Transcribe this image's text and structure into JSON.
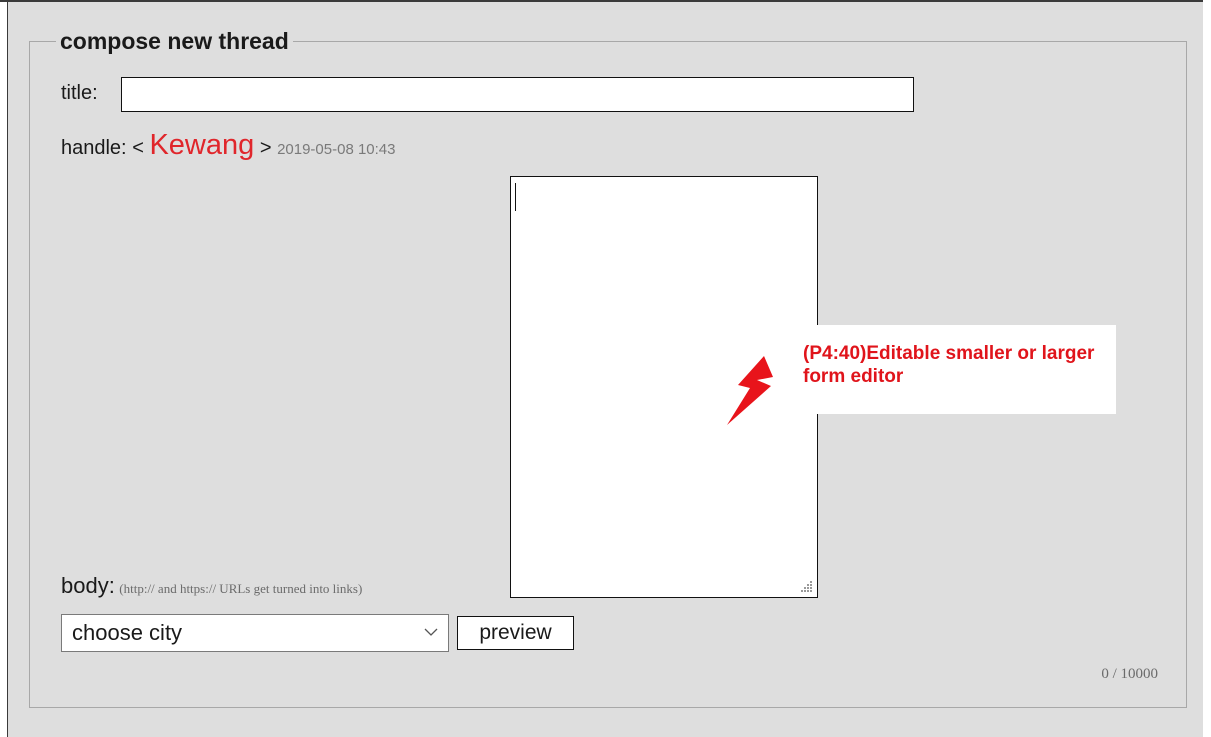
{
  "form": {
    "legend": "compose new thread",
    "title_label": "title:",
    "title_value": "",
    "handle_label": "handle:",
    "handle_open": "<",
    "handle_name": "Kewang",
    "handle_close": ">",
    "timestamp": "2019-05-08 10:43",
    "body_label": "body:",
    "body_hint": "(http:// and https:// URLs get turned into links)",
    "body_value": "",
    "city_select": "choose city",
    "preview_label": "preview",
    "char_counter": "0 / 10000"
  },
  "annotation": {
    "text": "(P4:40)Editable smaller or larger form editor",
    "color": "#e0141b"
  },
  "colors": {
    "panel_bg": "#dedede",
    "handle_name": "#e0262b"
  },
  "icons": {
    "select_arrow": "chevron-down-icon",
    "resize": "resize-grip-icon",
    "annotation_pointer": "lightning-arrow-icon"
  }
}
